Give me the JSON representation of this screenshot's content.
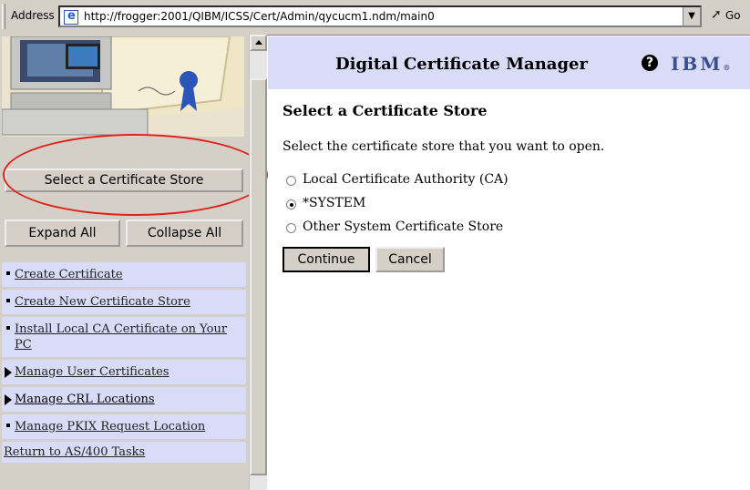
{
  "address_bar": {
    "label": "Address",
    "url": "http://frogger:2001/QIBM/ICSS/Cert/Admin/qycucm1.ndm/main0",
    "go_label": "Go"
  },
  "left_pane": {
    "select_store_button": "Select a Certificate Store",
    "expand_all": "Expand All",
    "collapse_all": "Collapse All",
    "nav_items": [
      {
        "label": "Create Certificate",
        "marker": "bullet"
      },
      {
        "label": "Create New Certificate Store",
        "marker": "bullet"
      },
      {
        "label": "Install Local CA Certificate on Your PC",
        "marker": "bullet"
      },
      {
        "label": "Manage User Certificates",
        "marker": "triangle"
      },
      {
        "label": "Manage CRL Locations",
        "marker": "triangle"
      },
      {
        "label": "Manage PKIX Request Location",
        "marker": "bullet"
      }
    ],
    "return_link": "Return to AS/400 Tasks"
  },
  "header": {
    "title": "Digital Certificate Manager",
    "help_icon": "?",
    "logo": "IBM",
    "logo_mark": "®"
  },
  "main": {
    "page_title": "Select a Certificate Store",
    "prompt": "Select the certificate store that you want to open.",
    "options": [
      {
        "label": "Local Certificate Authority (CA)",
        "selected": false
      },
      {
        "label": "*SYSTEM",
        "selected": true
      },
      {
        "label": "Other System Certificate Store",
        "selected": false
      }
    ],
    "continue_label": "Continue",
    "cancel_label": "Cancel"
  },
  "colors": {
    "nav_bg": "#d9dcf6",
    "chrome": "#d4d0c8",
    "highlight_ellipse": "#e0201a"
  }
}
